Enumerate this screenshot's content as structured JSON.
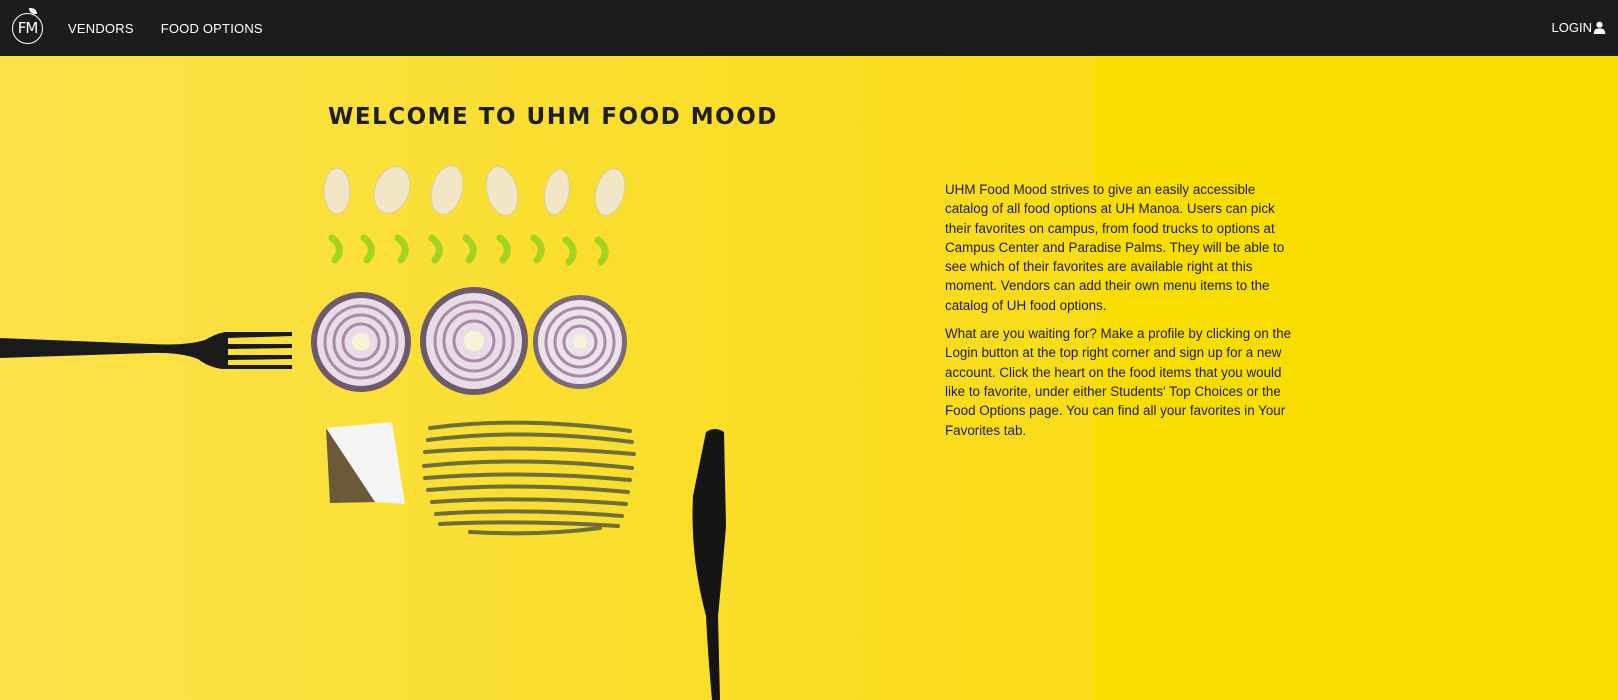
{
  "navbar": {
    "logo_text": "FM",
    "items": [
      {
        "label": "VENDORS"
      },
      {
        "label": "FOOD OPTIONS"
      }
    ],
    "login_label": "LOGIN"
  },
  "hero": {
    "title": "WELCOME TO UHM FOOD MOOD",
    "paragraphs": [
      "UHM Food Mood strives to give an easily accessible catalog of all food options at UH Manoa. Users can pick their favorites on campus, from food trucks to options at Campus Center and Paradise Palms. They will be able to see which of their favorites are available right at this moment. Vendors can add their own menu items to the catalog of UH food options.",
      "What are you waiting for? Make a profile by clicking on the Login button at the top right corner and sign up for a new account. Click the heart on the food items that you would like to favorite, under either Students' Top Choices or the Food Options page. You can find all your favorites in Your Favorites tab."
    ]
  },
  "colors": {
    "navbar_bg": "#1b1c1d",
    "hero_yellow": "#f9dc1c",
    "text_dark": "#1e1e1e"
  },
  "icons": {
    "logo": "fm-logo-icon",
    "login": "user-icon"
  }
}
